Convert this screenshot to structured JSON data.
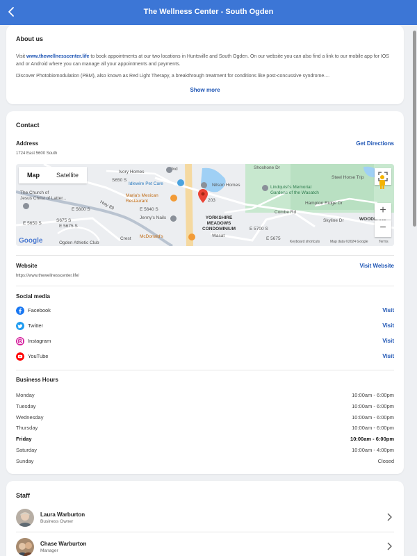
{
  "header": {
    "title": "The Wellness Center - South Ogden"
  },
  "about": {
    "heading": "About us",
    "p1_prefix": "Visit ",
    "p1_link": "www.thewellnesscenter.life",
    "p1_rest": " to book appointments at our two locations in Huntsville and South Ogden. On our website you can also find a link to our mobile app for IOS and or Android where you can manage all your appointments and payments.",
    "p2": "Discover Photobiomodulation (PBM), also known as Red Light Therapy, a breakthrough treatment for conditions like post-concussive syndrome....",
    "show_more": "Show more"
  },
  "contact": {
    "heading": "Contact",
    "address_label": "Address",
    "address_value": "1724 East 5600 South",
    "directions": "Get Directions",
    "map": {
      "tab_map": "Map",
      "tab_satellite": "Satellite",
      "labels": {
        "ivory": "Ivory Homes",
        "idlewire": "Idlewire Pet Care",
        "church": "The Church of\nJesus Christ of Latter...",
        "marias": "Maria's Mexican\nRestaurant",
        "jennys": "Jenny's Nails",
        "mcdonalds": "McDonald's",
        "nilson": "Nilson Homes",
        "lindquist": "Lindquist's Memorial\nGardens of the Wasatch",
        "steelhorse": "Steel Horse Trip",
        "yorkshire": "YORKSHIRE\nMEADOWS\nCONDOMINIUM",
        "woodland": "WOODLAND",
        "yorkshire2": "YORKSHIRE",
        "shoshone": "Shoshone Dr",
        "combe": "Combe Rd",
        "hampton": "Hampton Ridge Dr",
        "skyline": "Skyline Dr",
        "hwy": "Hwy 89",
        "e5600": "E 5600 S",
        "e5650": "E 5650 S",
        "e5675": "E 5675 S",
        "e5700": "E 5700 S",
        "e5640": "E 5640 S",
        "e5675b": "E 5675",
        "s5675": "S675 S",
        "s5650": "S650 S",
        "blvd": "Blvd",
        "r203": "203",
        "wasat": "Wasat",
        "athletic": "Ogden Athletic Club",
        "crest": "Crest"
      },
      "google": "Google",
      "shortcuts": "Keyboard shortcuts",
      "mapdata": "Map data ©2024 Google",
      "terms": "Terms",
      "zoom_in": "+",
      "zoom_out": "−"
    },
    "website_label": "Website",
    "website_value": "https://www.thewellnesscenter.life/",
    "visit_website": "Visit Website",
    "social_heading": "Social media",
    "social": [
      {
        "name": "Facebook",
        "action": "Visit",
        "color": "#1877f2"
      },
      {
        "name": "Twitter",
        "action": "Visit",
        "color": "#1d9bf0"
      },
      {
        "name": "Instagram",
        "action": "Visit",
        "color": "#d6249f"
      },
      {
        "name": "YouTube",
        "action": "Visit",
        "color": "#ff0000"
      }
    ],
    "hours_heading": "Business Hours",
    "hours": [
      {
        "day": "Monday",
        "time": "10:00am - 6:00pm"
      },
      {
        "day": "Tuesday",
        "time": "10:00am - 6:00pm"
      },
      {
        "day": "Wednesday",
        "time": "10:00am - 6:00pm"
      },
      {
        "day": "Thursday",
        "time": "10:00am - 6:00pm"
      },
      {
        "day": "Friday",
        "time": "10:00am - 6:00pm"
      },
      {
        "day": "Saturday",
        "time": "10:00am - 4:00pm"
      },
      {
        "day": "Sunday",
        "time": "Closed"
      }
    ]
  },
  "staff": {
    "heading": "Staff",
    "members": [
      {
        "name": "Laura Warburton",
        "role": "Business Owner"
      },
      {
        "name": "Chase Warburton",
        "role": "Manager"
      }
    ]
  },
  "colors": {
    "header": "#3c76d6",
    "link": "#1e55b4",
    "pin": "#ea4335"
  }
}
